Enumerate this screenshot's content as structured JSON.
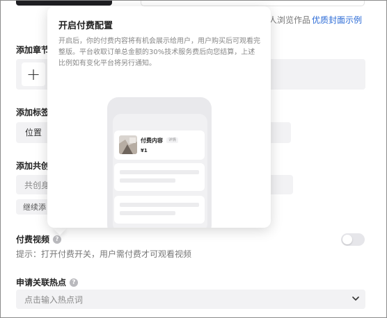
{
  "top": {
    "hint_text": "人浏览作品",
    "cover_example_link": "优质封面示例"
  },
  "sections": {
    "add_chapter_label": "添加章节",
    "add_tag_label": "添加标签",
    "location_label": "位置",
    "add_cocreator_label": "添加共创",
    "cocreator_placeholder": "共创身",
    "add_more_label": "继续添",
    "paid_video_label": "付费视频",
    "paid_video_hint": "提示：打开付费开关，用户需付费才可观看视频",
    "paid_video_enabled": false,
    "hot_topic_label": "申请关联热点",
    "hot_topic_placeholder": "点击输入热点词"
  },
  "popover": {
    "title": "开启付费配置",
    "body": "开启后，你的付费内容将有机会展示给用户，用户购买后可观看完整版。平台收取订单总金额的30%技术服务费后向您结算，上述比例如有变化平台将另行通知。",
    "preview": {
      "card_title": "付费内容",
      "card_badge": "详情",
      "card_price": "¥1"
    }
  },
  "icons": {
    "plus": "plus-icon",
    "question": "question-circle-icon",
    "chevron": "chevron-down-icon"
  },
  "colors": {
    "link": "#2a6ad6",
    "toggle_off": "#e6e6ea",
    "field_bg": "#f2f2f4"
  }
}
